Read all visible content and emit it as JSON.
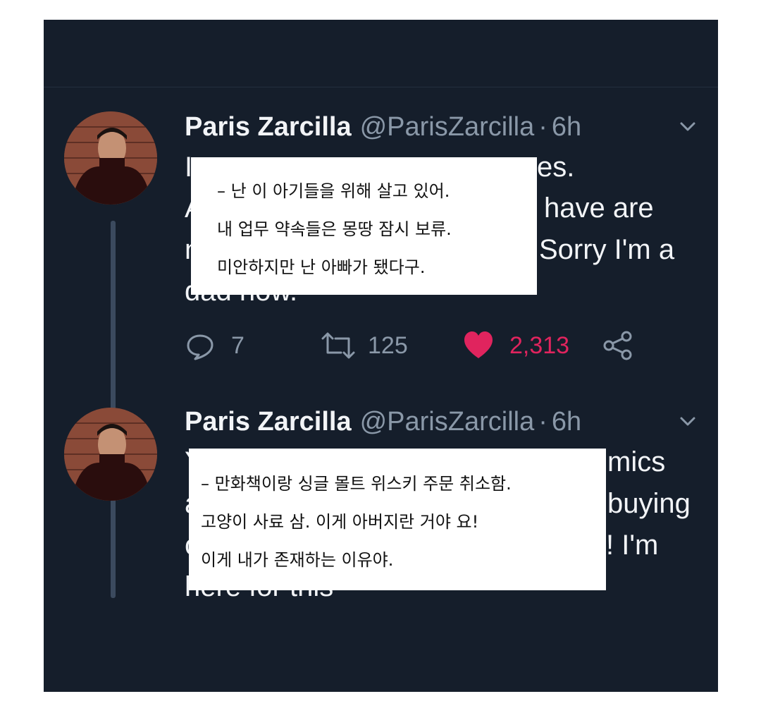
{
  "tweets": [
    {
      "author": {
        "name": "Paris Zarcilla",
        "handle": "@ParisZarcilla",
        "separator": "·",
        "time": "6h"
      },
      "visible_text_fragments": [
        "I",
        "es.",
        "A",
        "have are",
        "n",
        "Sorry I'm a",
        "dad now."
      ],
      "actions": {
        "replies": "7",
        "retweets": "125",
        "likes": "2,313"
      },
      "overlay_lines": [
        "– 난 이 아기들을 위해 살고 있어.",
        "내 업무 약속들은 몽땅 잠시 보류.",
        "미안하지만 난 아빠가 됐다구."
      ]
    },
    {
      "author": {
        "name": "Paris Zarcilla",
        "handle": "@ParisZarcilla",
        "separator": "·",
        "time": "6h"
      },
      "visible_text_fragments": [
        "Y",
        "mics",
        "a",
        "buying",
        "c",
        "! I'm",
        "here for this"
      ],
      "overlay_lines": [
        "– 만화책이랑 싱글 몰트 위스키 주문 취소함.",
        "고양이 사료 삼. 이게 아버지란 거야 요!",
        "이게 내가 존재하는 이유야."
      ]
    }
  ],
  "icons": {
    "reply": "speech-bubble-icon",
    "retweet": "retweet-icon",
    "like": "heart-icon",
    "share": "share-icon",
    "menu": "chevron-down-icon"
  },
  "colors": {
    "background": "#151e2b",
    "primary_text": "#f2f4f7",
    "secondary_text": "#8a98a8",
    "like": "#e0245e"
  }
}
